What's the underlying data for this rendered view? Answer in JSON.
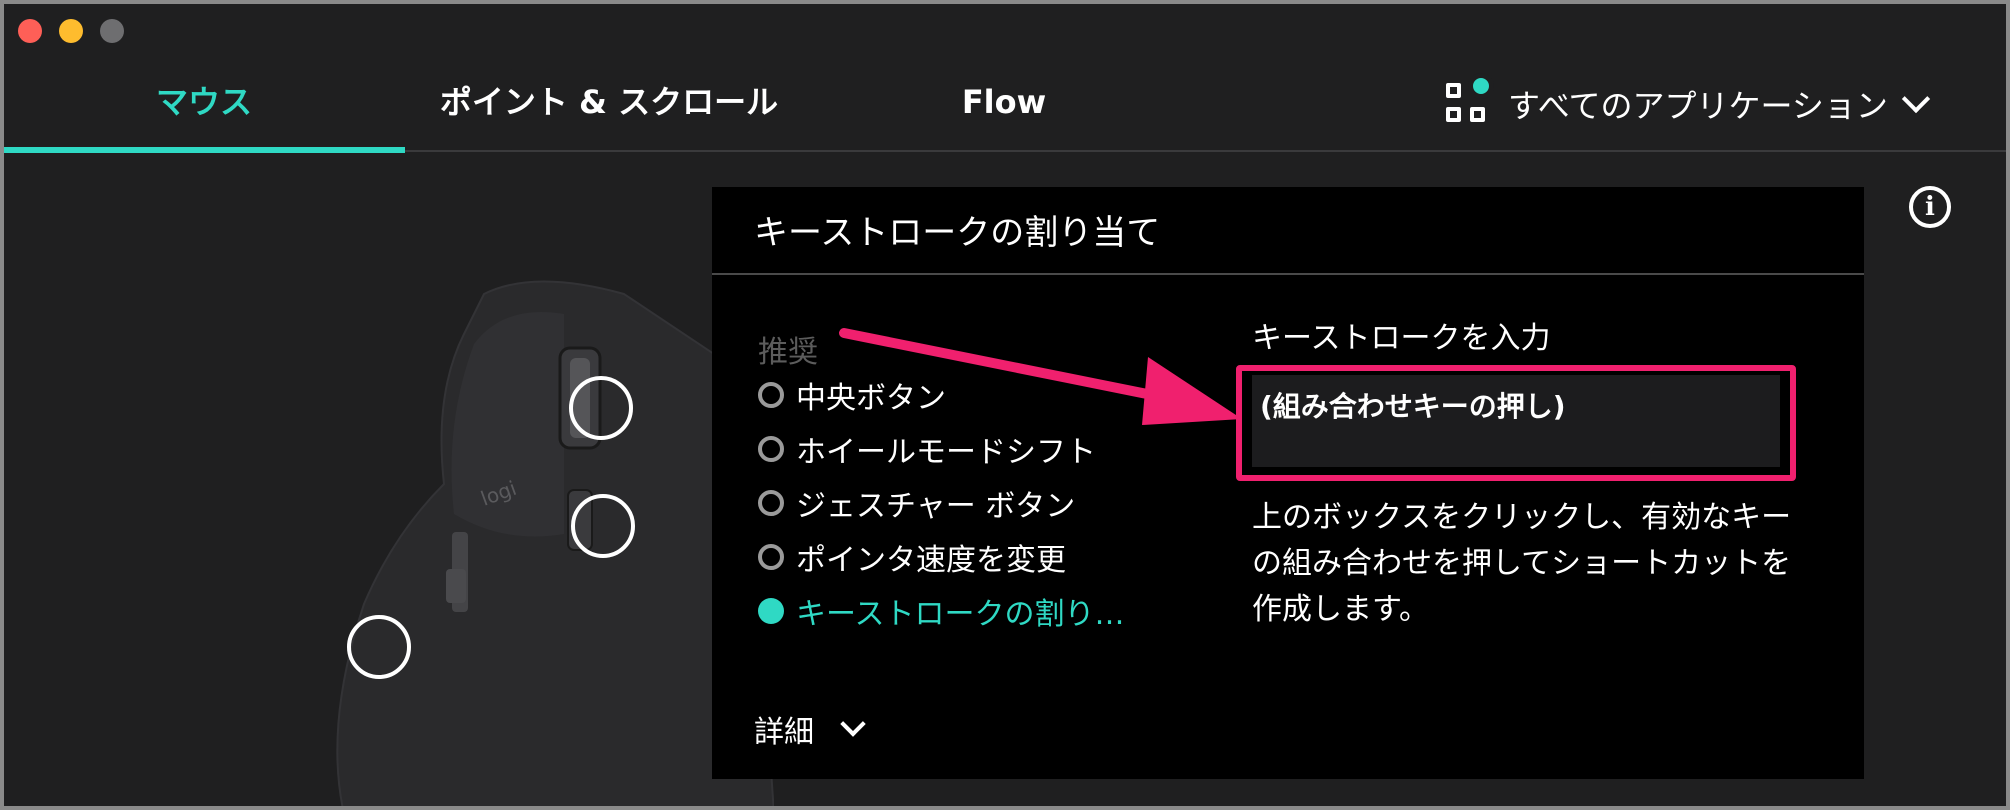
{
  "window_controls": {
    "close": "close",
    "minimize": "minimize",
    "maximize": "maximize"
  },
  "tabs": [
    {
      "label": "マウス",
      "active": true
    },
    {
      "label": "ポイント & スクロール",
      "active": false
    },
    {
      "label": "Flow",
      "active": false
    }
  ],
  "app_selector": {
    "label": "すべてのアプリケーション",
    "icon": "grid-icon",
    "accent": "#2fd9c4"
  },
  "popup": {
    "title": "キーストロークの割り当て",
    "section_label": "推奨",
    "options": [
      {
        "label": "中央ボタン",
        "selected": false
      },
      {
        "label": "ホイールモードシフト",
        "selected": false
      },
      {
        "label": "ジェスチャー ボタン",
        "selected": false
      },
      {
        "label": "ポインタ速度を変更",
        "selected": false
      },
      {
        "label": "キーストロークの割り…",
        "selected": true
      }
    ],
    "details_label": "詳細",
    "right_heading": "キーストロークを入力",
    "keystroke_value": "(組み合わせキーの押し)",
    "help_text": "上のボックスをクリックし、有効なキーの組み合わせを押してショートカットを作成します。"
  },
  "mouse": {
    "brand": "logi"
  },
  "colors": {
    "accent": "#2fd9c4",
    "highlight": "#f0206e",
    "background": "#1f1f20"
  }
}
